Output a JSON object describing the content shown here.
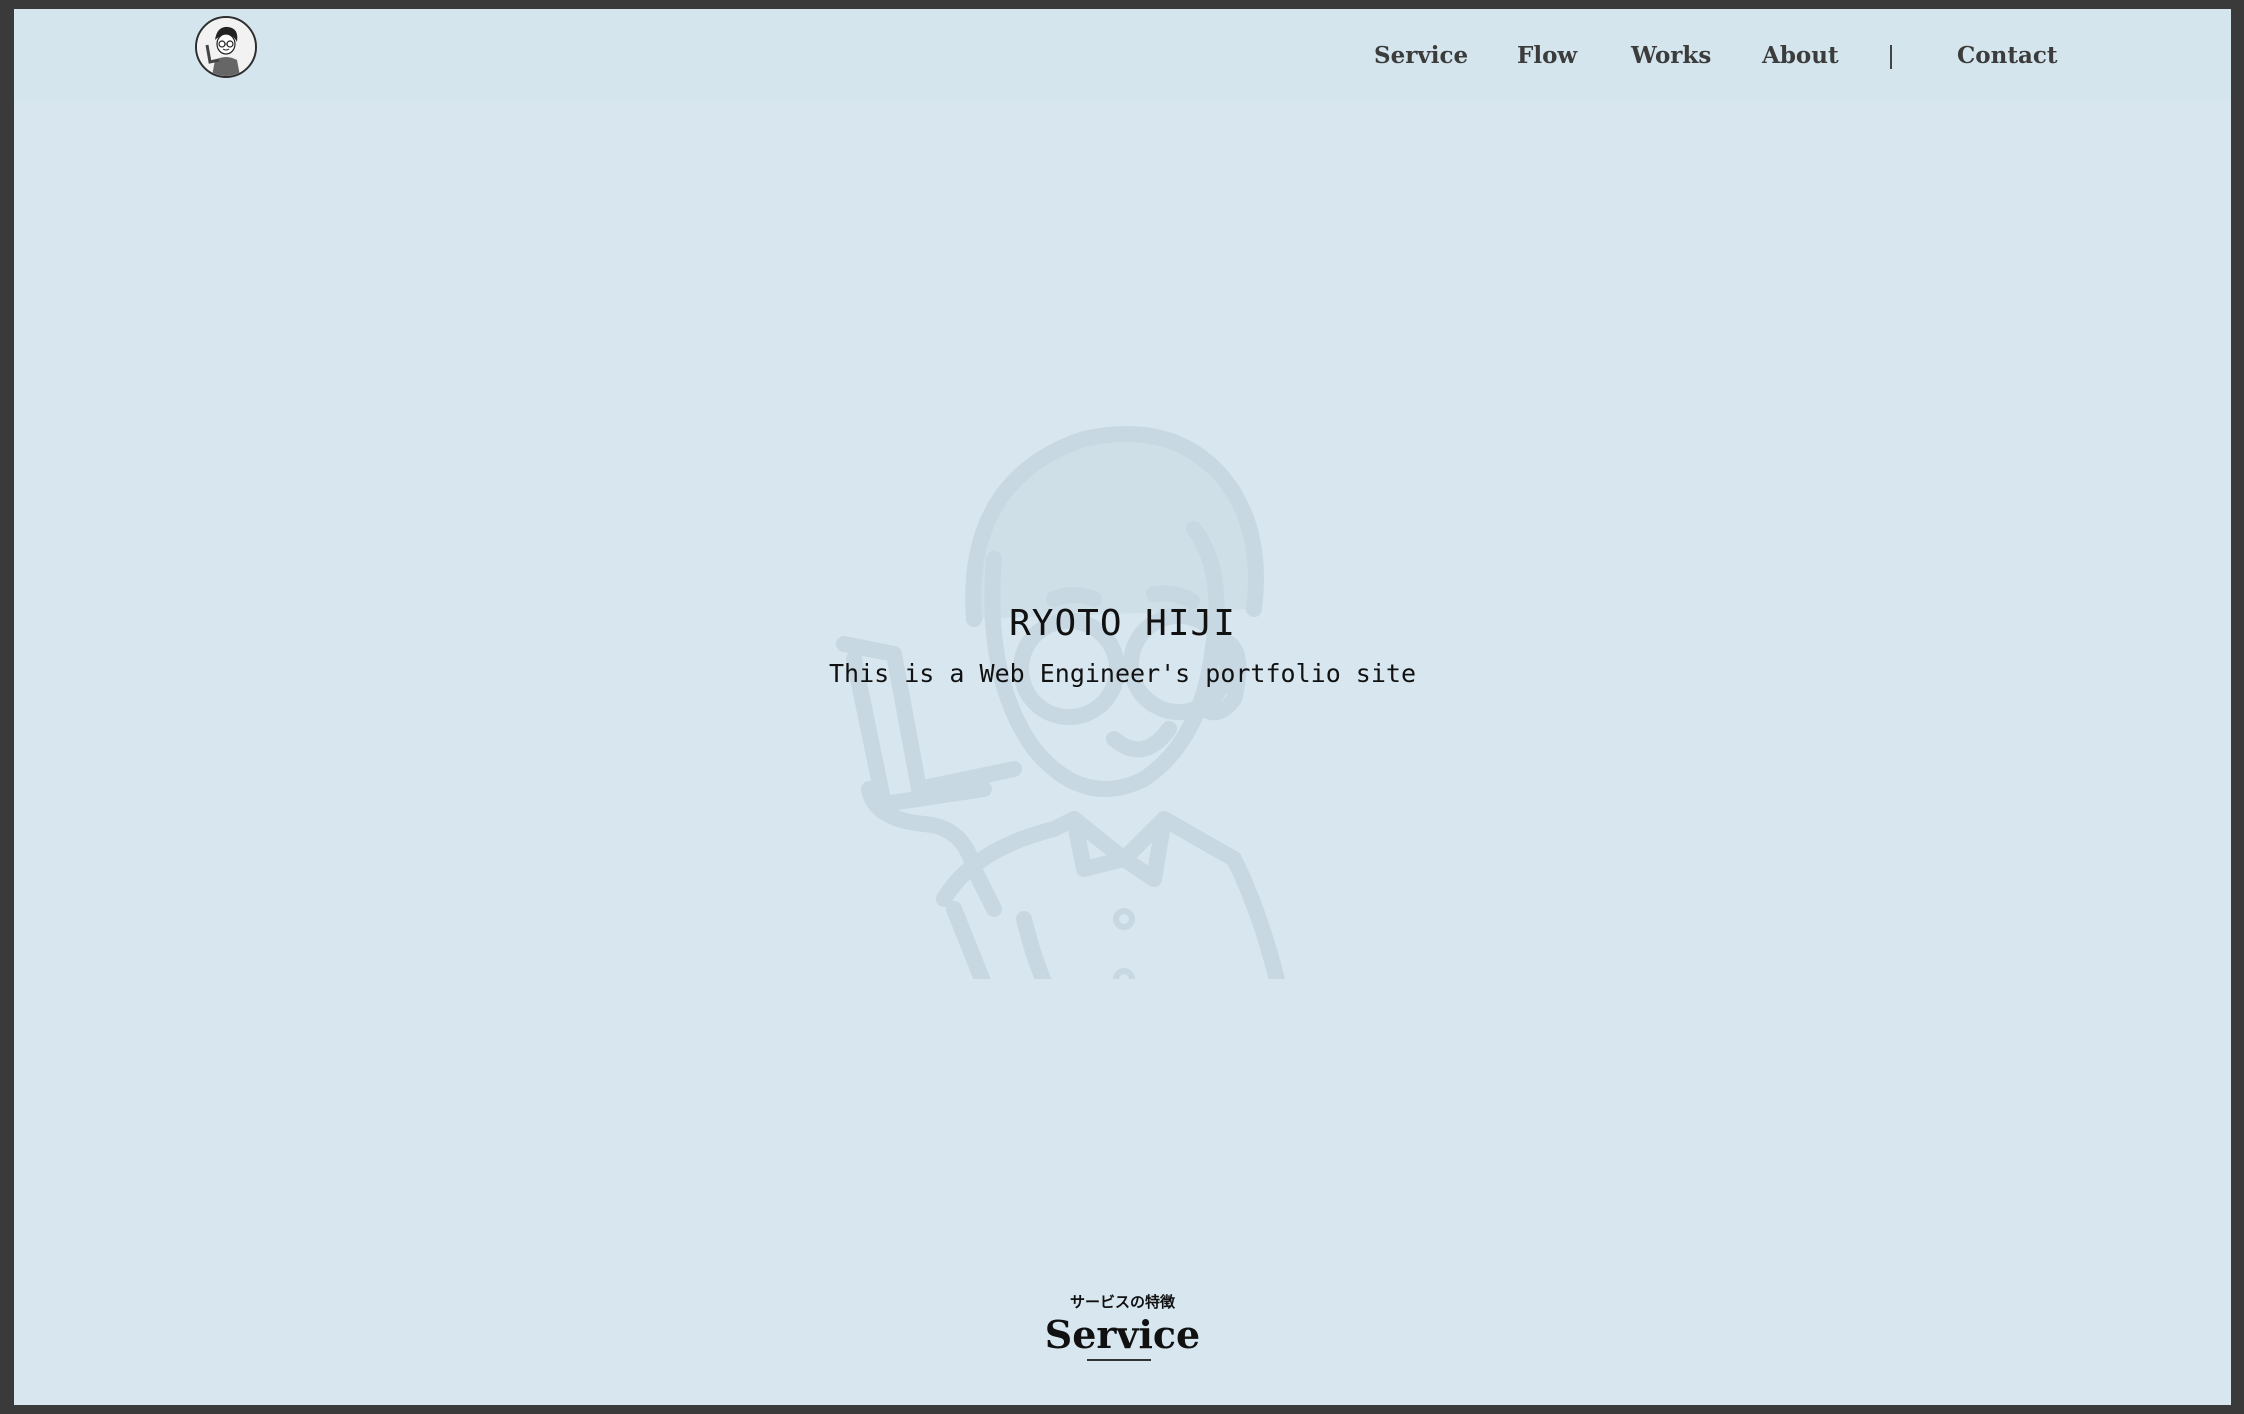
{
  "header": {
    "logo_icon": "avatar-logo-icon",
    "nav": [
      {
        "label": "Service"
      },
      {
        "label": "Flow"
      },
      {
        "label": "Works"
      },
      {
        "label": "About"
      },
      {
        "label": "Contact"
      }
    ]
  },
  "hero": {
    "title": "RYOTO HIJI",
    "subtitle": "This is a Web Engineer's portfolio site",
    "illustration_icon": "engineer-with-laptop-illustration"
  },
  "service_section": {
    "subtitle": "サービスの特徴",
    "title": "Service"
  },
  "colors": {
    "background": "#d8e7ef",
    "header_background": "#d4e5ee",
    "text": "#111111",
    "nav_text": "#3c3c3c",
    "outer_frame": "#3a3a3a"
  }
}
